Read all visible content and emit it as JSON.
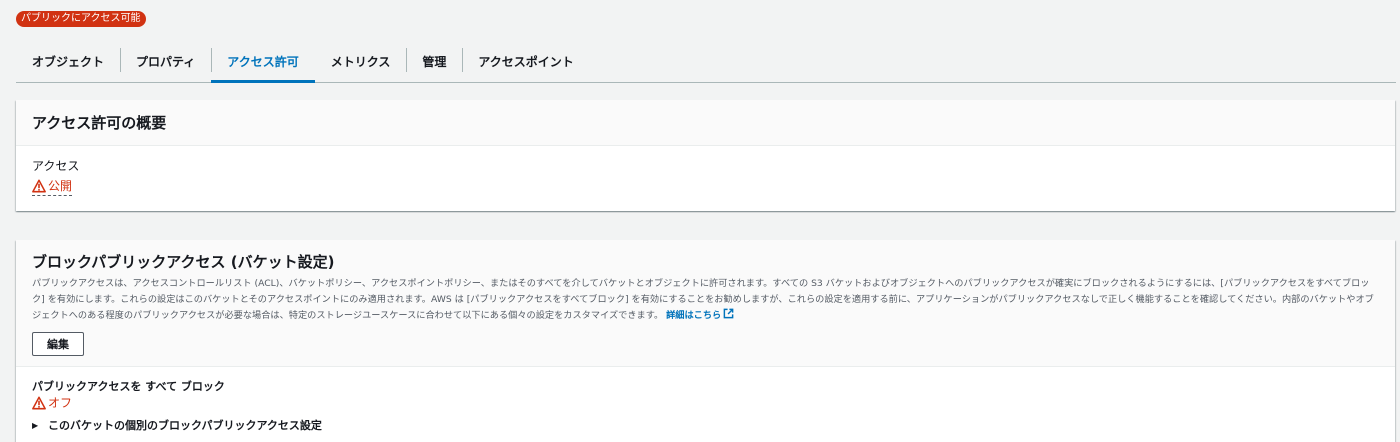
{
  "badge": {
    "label": "パブリックにアクセス可能"
  },
  "tabs": [
    {
      "label": "オブジェクト",
      "active": false
    },
    {
      "label": "プロパティ",
      "active": false
    },
    {
      "label": "アクセス許可",
      "active": true
    },
    {
      "label": "メトリクス",
      "active": false
    },
    {
      "label": "管理",
      "active": false
    },
    {
      "label": "アクセスポイント",
      "active": false
    }
  ],
  "overview": {
    "title": "アクセス許可の概要",
    "access_label": "アクセス",
    "access_value": "公開"
  },
  "block_public_access": {
    "title": "ブロックパブリックアクセス (バケット設定)",
    "description": "パブリックアクセスは、アクセスコントロールリスト (ACL)、バケットポリシー、アクセスポイントポリシー、またはそのすべてを介してバケットとオブジェクトに許可されます。すべての S3 バケットおよびオブジェクトへのパブリックアクセスが確実にブロックされるようにするには、[パブリックアクセスをすべてブロック] を有効にします。これらの設定はこのバケットとそのアクセスポイントにのみ適用されます。AWS は [パブリックアクセスをすべてブロック] を有効にすることをお勧めしますが、これらの設定を適用する前に、アプリケーションがパブリックアクセスなしで正しく機能することを確認してください。内部のバケットやオブジェクトへのある程度のパブリックアクセスが必要な場合は、特定のストレージユースケースに合わせて以下にある個々の設定をカスタマイズできます。",
    "learn_more": "詳細はこちら",
    "edit_label": "編集",
    "setting_title": "パブリックアクセスを すべて ブロック",
    "setting_value": "オフ",
    "expander_label": "このバケットの個別のブロックパブリックアクセス設定"
  },
  "colors": {
    "accent": "#0073bb",
    "danger": "#d13212",
    "text": "#16191f",
    "background": "#f2f3f3"
  },
  "icons": {
    "warning": "warning-icon",
    "external": "external-link-icon",
    "caret": "caret-right-icon"
  }
}
